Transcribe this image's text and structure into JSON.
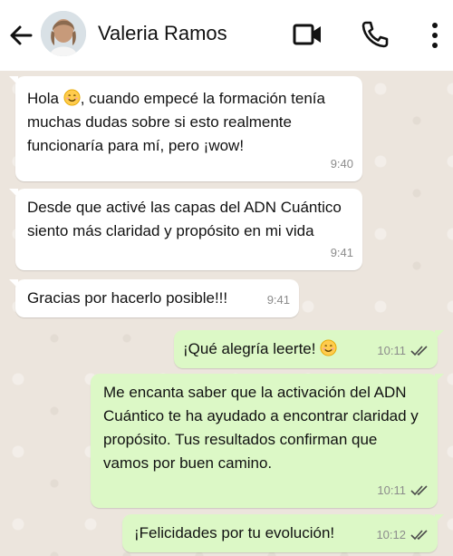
{
  "header": {
    "contact_name": "Valeria Ramos",
    "back_icon": "arrow-left-icon",
    "video_icon": "video-camera-icon",
    "call_icon": "phone-icon",
    "menu_icon": "more-vertical-icon"
  },
  "colors": {
    "incoming_bubble": "#ffffff",
    "outgoing_bubble": "#dcf8c6",
    "chat_background": "#ece5dd",
    "read_receipt": "#4a4a4a"
  },
  "messages": [
    {
      "direction": "incoming",
      "text_before_emoji": "Hola ",
      "emoji": "smiling-face",
      "text_after_emoji": ", cuando empecé la formación tenía muchas dudas sobre si esto realmente funcionaría para mí, pero ¡wow!",
      "time": "9:40"
    },
    {
      "direction": "incoming",
      "text": "Desde que activé las capas del ADN Cuántico siento más claridad y propósito en mi vida",
      "time": "9:41"
    },
    {
      "direction": "incoming",
      "text": "Gracias por hacerlo posible!!!",
      "time": "9:41"
    },
    {
      "direction": "outgoing",
      "text": "¡Qué alegría leerte! ",
      "emoji": "smiling-face",
      "time": "10:11",
      "status": "read"
    },
    {
      "direction": "outgoing",
      "text": "Me encanta saber que la activación del ADN Cuántico te ha ayudado a encontrar claridad y propósito. Tus resultados confirman que vamos por buen camino.",
      "time": "10:11",
      "status": "read"
    },
    {
      "direction": "outgoing",
      "text": "¡Felicidades por tu evolución!",
      "time": "10:12",
      "status": "read"
    }
  ]
}
